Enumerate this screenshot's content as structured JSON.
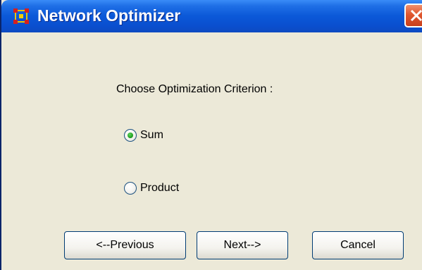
{
  "window": {
    "title": "Network Optimizer",
    "icon": "network-grid-icon",
    "close_icon": "close-icon",
    "accent_color": "#0a58d8",
    "background_color": "#ece9d8"
  },
  "form": {
    "prompt": "Choose Optimization Criterion :",
    "options": [
      {
        "label": "Sum",
        "selected": true
      },
      {
        "label": "Product",
        "selected": false
      }
    ]
  },
  "buttons": {
    "previous_label": "<--Previous",
    "next_label": "Next-->",
    "cancel_label": "Cancel"
  }
}
